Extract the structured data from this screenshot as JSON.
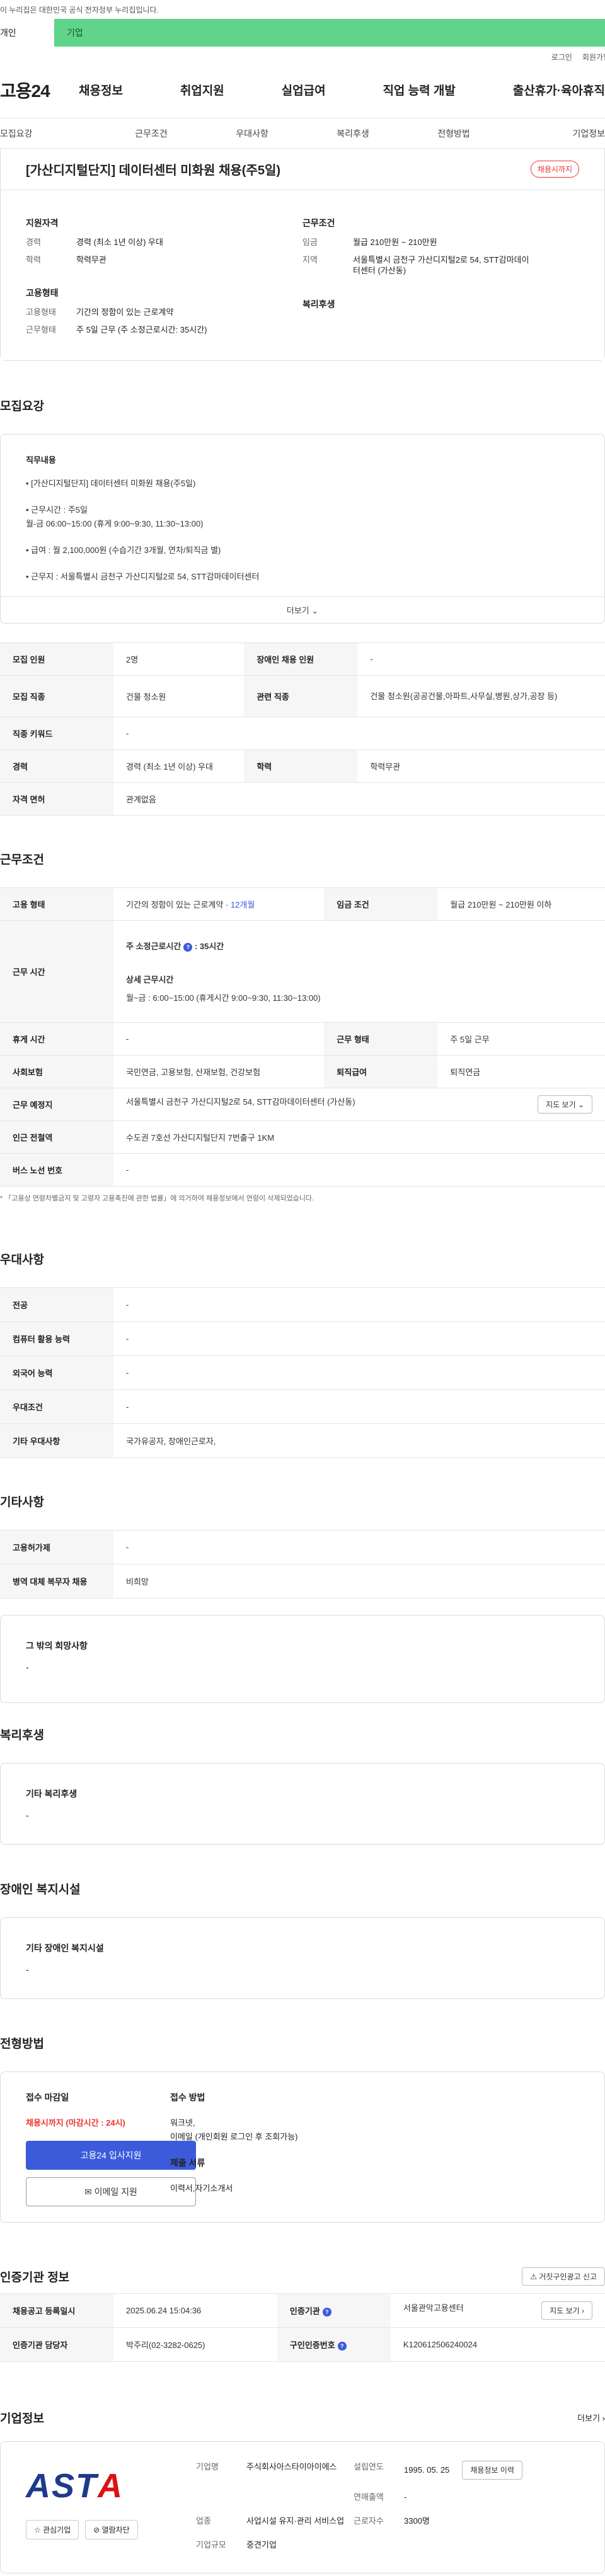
{
  "notice": "이 누리집은 대한민국 공식 전자정부 누리집입니다.",
  "top_tabs": [
    "개인",
    "기업"
  ],
  "util": [
    "로그인",
    "회원가입"
  ],
  "logo": "고용24",
  "gnb": [
    "채용정보",
    "취업지원",
    "실업급여",
    "직업 능력 개발",
    "출산휴가·육아휴직"
  ],
  "anchor": [
    "모집요강",
    "근무조건",
    "우대사항",
    "복리후생",
    "전형방법",
    "기업정보"
  ],
  "job": {
    "title": "[가산디지털단지] 데이터센터 미화원 채용(주5일)",
    "status": "채용시까지"
  },
  "summary": {
    "qual_h": "지원자격",
    "career_k": "경력",
    "career_v": "경력 (최소 1년 이상) 우대",
    "edu_k": "학력",
    "edu_v": "학력무관",
    "emp_h": "고용형태",
    "emp_k": "고용형태",
    "emp_v": "기간의 정함이 있는 근로계약",
    "work_k": "근무형태",
    "work_v": "주 5일 근무 (주 소정근로시간: 35시간)",
    "cond_h": "근무조건",
    "wage_k": "임금",
    "wage_v": "월급 210만원 ~ 210만원",
    "loc_k": "지역",
    "loc_v": "서울특별시 금천구 가산디지털2로 54, STT감마데이터센터 (가산동)",
    "welfare_h": "복리후생"
  },
  "recruit": {
    "title": "모집요강",
    "desc_h": "직무내용",
    "items": [
      "• [가산디지털단지] 데이터센터 미화원 채용(주5일)",
      "• 근무시간 :   주5일\n                         월-금 06:00~15:00 (휴게 9:00~9:30, 11:30~13:00)",
      "• 급여 : 월 2,100,000원 (수습기간 3개월, 연차/퇴직금 별)",
      "• 근무지 : 서울특별시 금천구 가산디지털2로 54, STT감마데이터센터"
    ],
    "more": "더보기 ⌄",
    "rows": [
      [
        "모집 인원",
        "2명",
        "장애인 채용 인원",
        "-"
      ],
      [
        "모집 직종",
        "건물 청소원",
        "관련 직종",
        "건물 청소원(공공건물,아파트,사무실,병원,상가,공장 등)"
      ],
      [
        "직종 키워드",
        "-",
        "",
        ""
      ],
      [
        "경력",
        "경력 (최소 1년 이상) 우대",
        "학력",
        "학력무관"
      ],
      [
        "자격 면허",
        "관계없음",
        "",
        ""
      ]
    ]
  },
  "work": {
    "title": "근무조건",
    "emp_k": "고용 형태",
    "emp_v": "기간의 정함이 있는 근로계약 · ",
    "emp_v2": "12개월",
    "wage_k": "임금 조건",
    "wage_v": "월급 210만원 ~ 210만원 이하",
    "time_k": "근무 시간",
    "time_weekly": "주 소정근로시간",
    "time_weekly_v": ": 35시간",
    "time_detail_h": "상세 근무시간",
    "time_detail_v": "월~금 : 6:00~15:00 (휴게시간 9:00~9:30, 11:30~13:00)",
    "break_k": "휴게 시간",
    "break_v": "-",
    "form_k": "근무 형태",
    "form_v": "주 5일 근무",
    "ins_k": "사회보험",
    "ins_v": "국민연금, 고용보험, 산재보험, 건강보험",
    "ret_k": "퇴직급여",
    "ret_v": "퇴직연금",
    "place_k": "근무 예정지",
    "place_v": "서울특별시 금천구 가산디지털2로 54, STT감마데이터센터 (가산동)",
    "map_btn": "지도 보기 ⌄",
    "sub_k": "인근 전철역",
    "sub_v": "수도권 7호선 가산디지털단지 7번출구 1KM",
    "bus_k": "버스 노선 번호",
    "bus_v": "-",
    "note": "* 「고용상 연령차별금지 및 고령자 고용촉진에 관한 법률」에 의거하여 채용정보에서 연령이 삭제되었습니다."
  },
  "prefer": {
    "title": "우대사항",
    "rows": [
      [
        "전공",
        "-"
      ],
      [
        "컴퓨터 활용 능력",
        "-"
      ],
      [
        "외국어 능력",
        "-"
      ],
      [
        "우대조건",
        "-"
      ],
      [
        "기타 우대사항",
        "국가유공자, 장애인근로자,"
      ]
    ]
  },
  "etc": {
    "title": "기타사항",
    "rows": [
      [
        "고용허가제",
        "-"
      ],
      [
        "병역 대체 복무자 채용",
        "비희망"
      ]
    ],
    "other_h": "그 밖의 희망사항",
    "other_v": "-"
  },
  "welfare": {
    "title": "복리후생",
    "h": "기타 복리후생",
    "v": "-"
  },
  "disabled": {
    "title": "장애인 복지시설",
    "h": "기타 장애인 복지시설",
    "v": "-"
  },
  "process": {
    "title": "전형방법",
    "deadline_h": "접수 마감일",
    "deadline_v": "채용시까지 (마감시간 : 24시)",
    "apply_btn": "고용24 입사지원",
    "email_btn": "✉ 이메일 지원",
    "method_h": "접수 방법",
    "method_v": "워크넷,\n이메일 (개인회원 로그인 후 조회가능)",
    "docs_h": "제출 서류",
    "docs_v": "이력서,자기소개서"
  },
  "cert": {
    "title": "인증기관 정보",
    "report_btn": "⚠ 거짓구인광고 신고",
    "reg_k": "채용공고 등록일시",
    "reg_v": "2025.06.24 15:04:36",
    "org_k": "인증기관",
    "org_v": "서울관악고용센터",
    "map_btn": "지도 보기 ›",
    "staff_k": "인증기관 담당자",
    "staff_v": "박주리(02-3282-0625)",
    "id_k": "구인인증번호",
    "id_v": "K120612506240024"
  },
  "company": {
    "title": "기업정보",
    "more": "더보기 ›",
    "logo_a": "AST",
    "logo_b": "A",
    "fav_btn": "☆ 관심기업",
    "block_btn": "⊘ 열람차단",
    "name_k": "기업명",
    "name_v": "주식회사아스타이아이에스",
    "est_k": "설립연도",
    "est_v": "1995. 05. 25",
    "info_btn": "채용정보 이력",
    "ind_k": "업종",
    "ind_v": "사업시설 유지·관리 서비스업",
    "rev_k": "연매출액",
    "rev_v": "-",
    "emp_k": "근로자수",
    "emp_v": "3300명",
    "size_k": "기업규모",
    "size_v": "중견기업"
  }
}
